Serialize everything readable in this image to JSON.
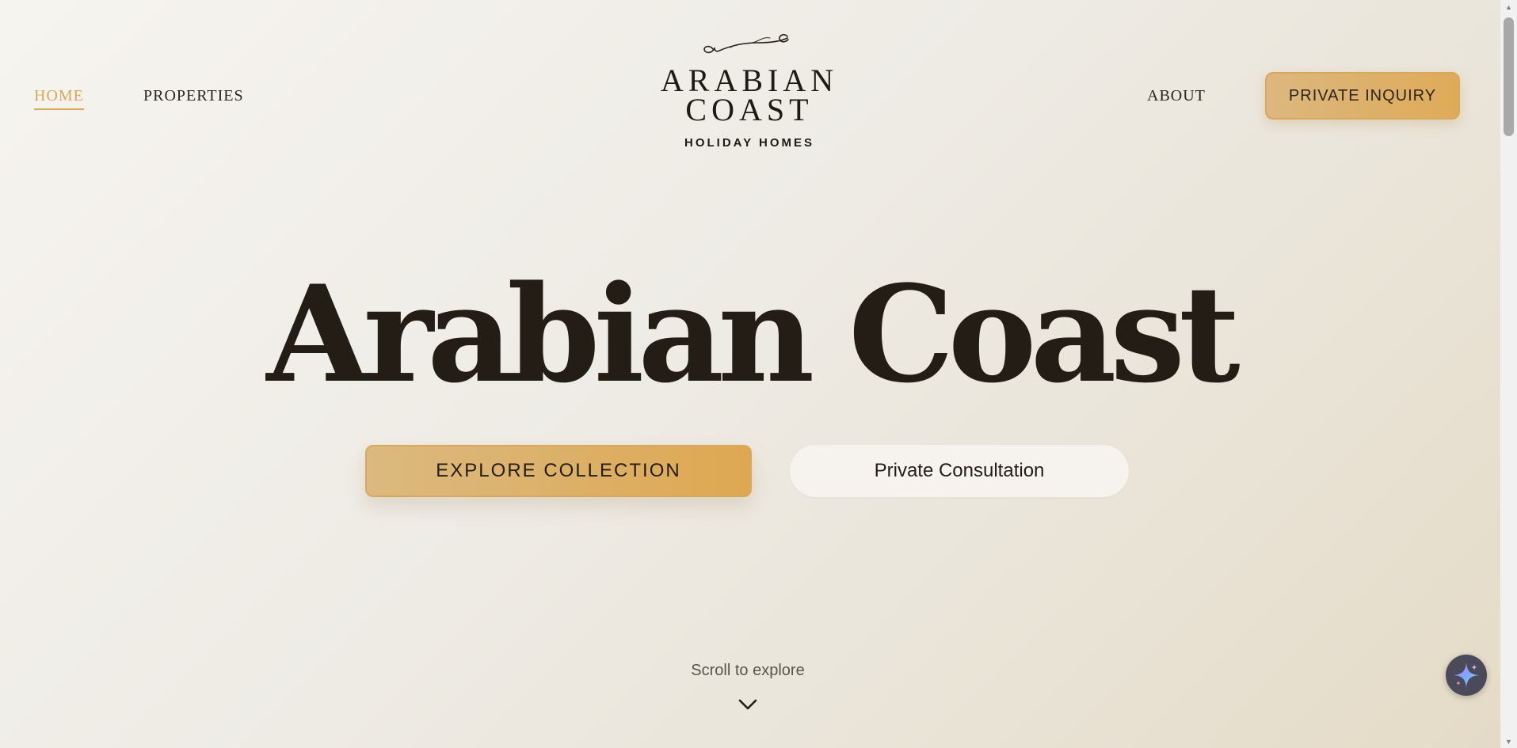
{
  "header": {
    "nav_left": [
      {
        "label": "HOME",
        "active": true
      },
      {
        "label": "PROPERTIES",
        "active": false
      }
    ],
    "nav_right": [
      {
        "label": "ABOUT"
      }
    ],
    "cta_label": "PRIVATE INQUIRY"
  },
  "logo": {
    "monogram": "a c",
    "line1": "ARABIAN",
    "line2": "COAST",
    "subtitle": "HOLIDAY HOMES"
  },
  "hero": {
    "title": "Arabian Coast",
    "primary_button": "EXPLORE COLLECTION",
    "secondary_button": "Private Consultation"
  },
  "scroll_hint": {
    "text": "Scroll to explore",
    "icon": "chevron-down-icon"
  },
  "assistant": {
    "icon": "sparkle-icon"
  },
  "colors": {
    "accent_gold": "#d7a85a",
    "text_dark": "#231d16",
    "background": "#efece6"
  }
}
